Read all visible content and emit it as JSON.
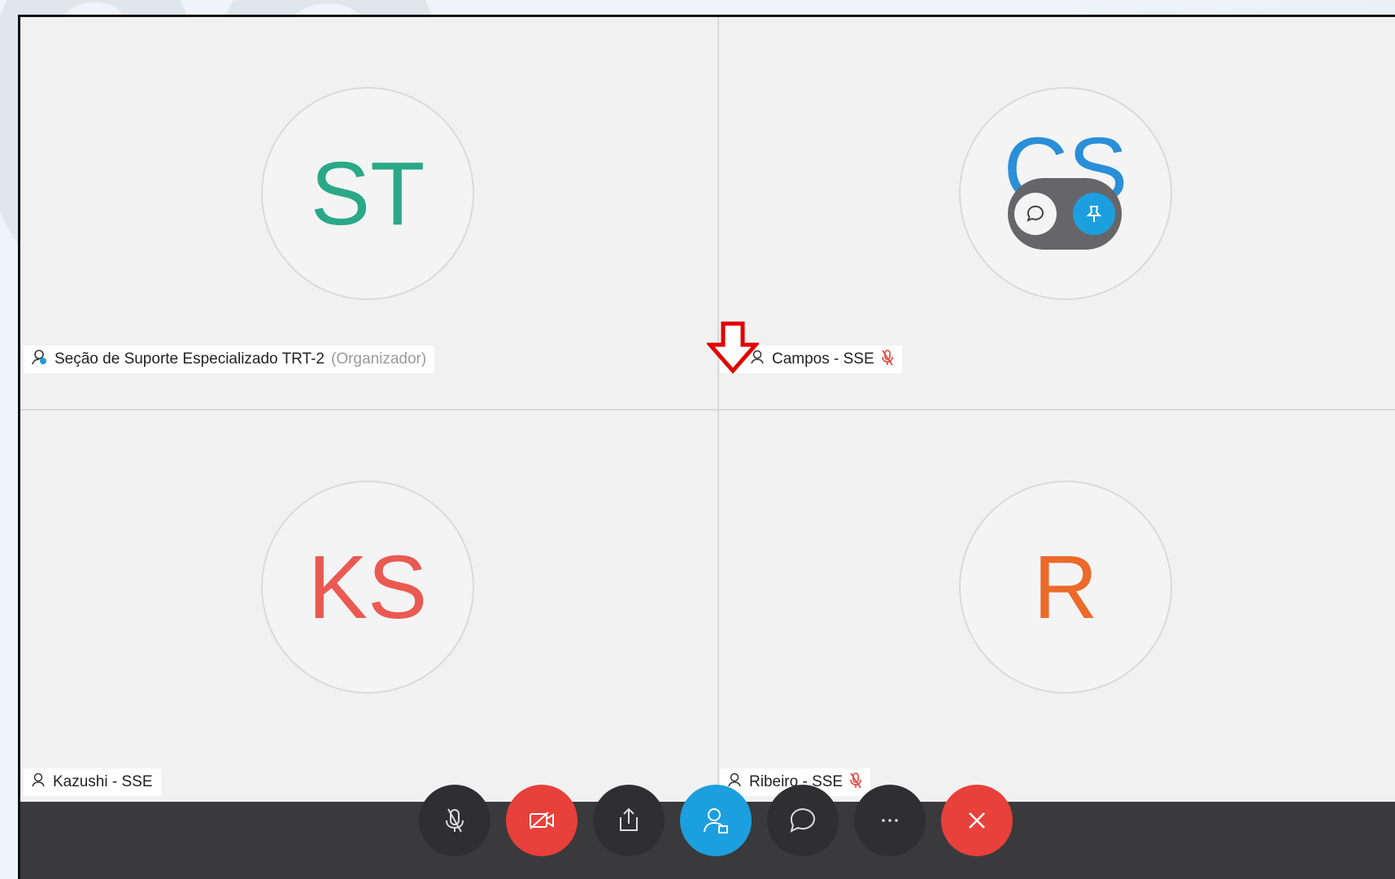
{
  "background": {
    "number": "03",
    "color": "#dfe7ed"
  },
  "tiles": [
    {
      "initials": "ST",
      "color": "#2aa887",
      "name": "Seção de Suporte Especializado TRT-2",
      "role": "(Organizador)"
    },
    {
      "initials": "CS",
      "color": "#2a8fd8",
      "name": "Campos - SSE"
    },
    {
      "initials": "KS",
      "color": "#ea5a52",
      "name": "Kazushi - SSE"
    },
    {
      "initials": "R",
      "color": "#ec6a2a",
      "name": "Ribeiro - SSE"
    }
  ],
  "toolbar": {
    "buttons": [
      {
        "name": "mute",
        "icon": "mic-off-icon",
        "style": "dark"
      },
      {
        "name": "video",
        "icon": "video-off-icon",
        "style": "red"
      },
      {
        "name": "share",
        "icon": "share-icon",
        "style": "dark"
      },
      {
        "name": "participants",
        "icon": "participants-icon",
        "style": "blue"
      },
      {
        "name": "chat",
        "icon": "chat-icon",
        "style": "dark"
      },
      {
        "name": "more",
        "icon": "more-icon",
        "style": "dark"
      },
      {
        "name": "leave",
        "icon": "close-icon",
        "style": "red"
      }
    ]
  },
  "overlay": {
    "icons": [
      "chat-icon",
      "pin-icon"
    ]
  },
  "colors": {
    "accent_blue": "#1c9fde",
    "danger_red": "#e8403a",
    "toolbar_bg": "#3a3a3d",
    "arrow_red": "#e00000"
  }
}
